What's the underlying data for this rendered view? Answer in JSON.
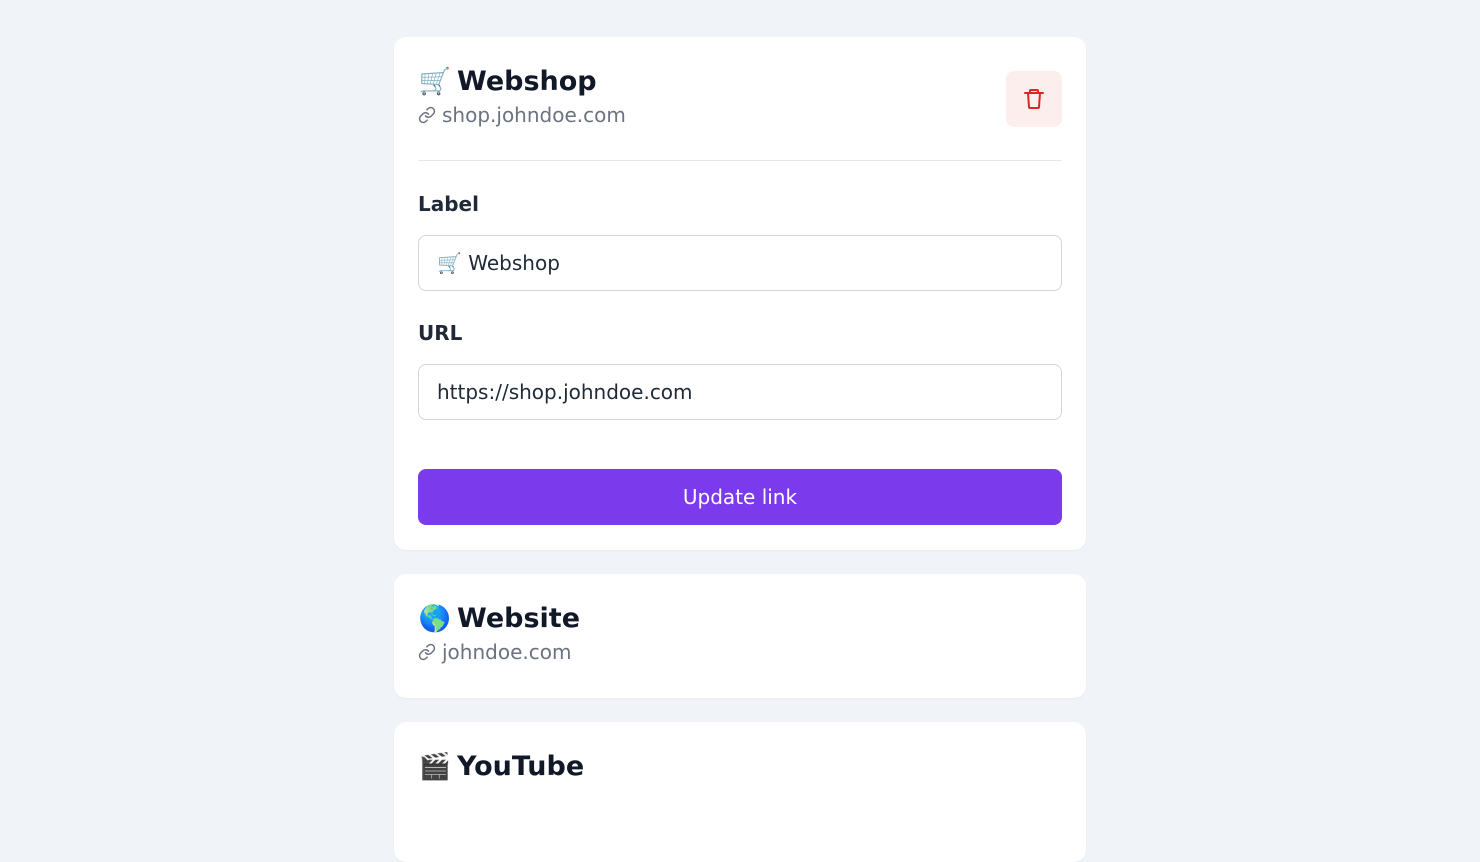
{
  "links": [
    {
      "emoji": "🛒",
      "title": "Webshop",
      "url_display": "shop.johndoe.com",
      "label_field_label": "Label",
      "label_value": "🛒 Webshop",
      "url_field_label": "URL",
      "url_value": "https://shop.johndoe.com",
      "update_label": "Update link"
    },
    {
      "emoji": "🌎",
      "title": "Website",
      "url_display": "johndoe.com"
    },
    {
      "emoji": "🎬",
      "title": "YouTube"
    }
  ],
  "icons": {
    "delete": "trash-icon",
    "link": "link-icon"
  },
  "colors": {
    "accent": "#7c3aed",
    "danger": "#dc2626",
    "danger_bg": "#fdeeee",
    "background": "#f0f3f8"
  }
}
